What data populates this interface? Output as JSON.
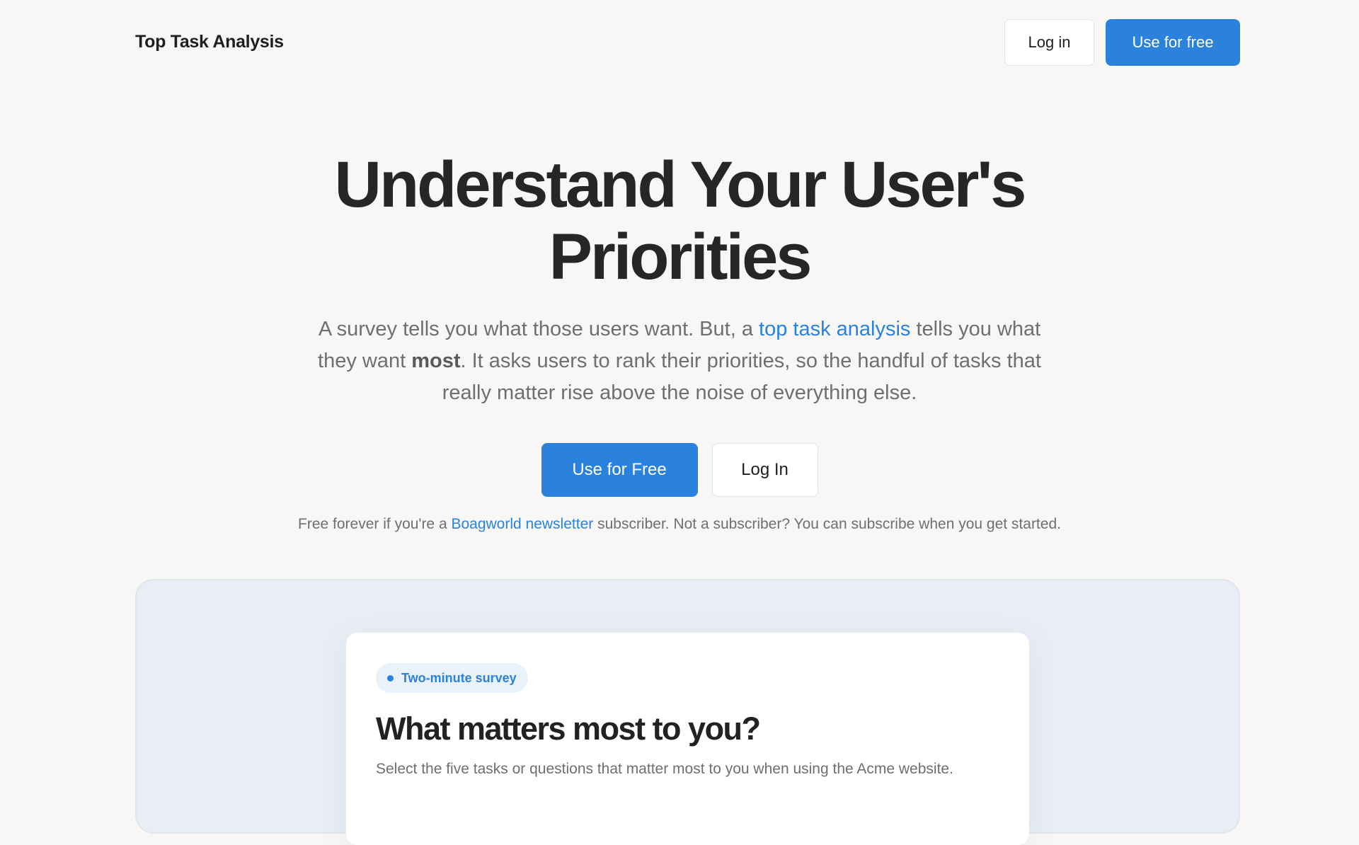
{
  "header": {
    "brand": "Top Task Analysis",
    "login_label": "Log in",
    "use_label": "Use for free"
  },
  "hero": {
    "title_line1": "Understand Your User's",
    "title_line2": "Priorities",
    "subtitle": {
      "part1": "A survey tells you what those users want. But, a ",
      "link": "top task analysis",
      "part2": " tells you what they want ",
      "emphasis": "most",
      "part3": ". It asks users to rank their priorities, so the handful of tasks that really matter rise above the noise of everything else."
    },
    "primary_cta": "Use for Free",
    "secondary_cta": "Log In",
    "note": {
      "part1": "Free forever if you're a ",
      "link": "Boagworld newsletter",
      "part2": " subscriber. Not a subscriber? You can subscribe when you get started."
    }
  },
  "preview": {
    "badge": "Two-minute survey",
    "title": "What matters most to you?",
    "description": "Select the five tasks or questions that matter most to you when using the Acme website."
  },
  "colors": {
    "background": "#f8f7f6",
    "accent": "#2a82dd",
    "text": "#222222",
    "muted": "#6f6f6f",
    "panel": "#e8eef4"
  }
}
